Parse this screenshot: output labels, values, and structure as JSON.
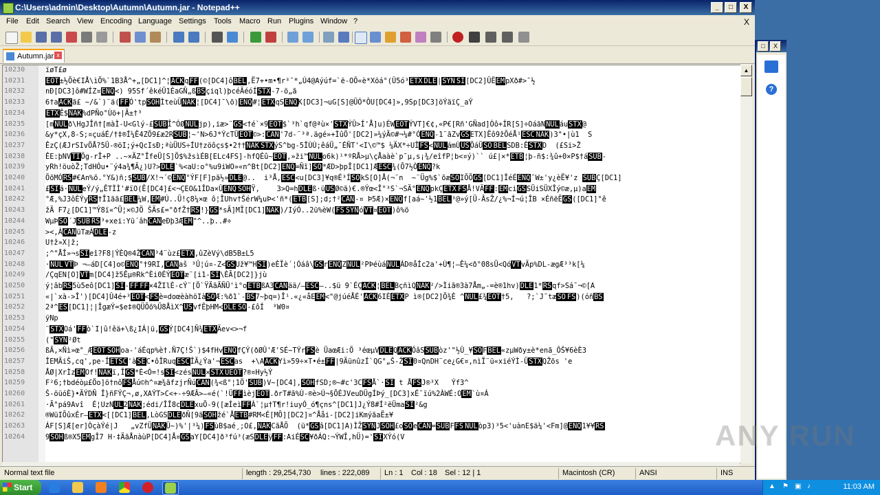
{
  "window": {
    "title": "C:\\Users\\admin\\Desktop\\Autumn\\Autumn.jar - Notepad++"
  },
  "title_buttons": {
    "minimize": "_",
    "maximize": "□",
    "close": "X"
  },
  "menu": [
    "File",
    "Edit",
    "Search",
    "View",
    "Encoding",
    "Language",
    "Settings",
    "Tools",
    "Macro",
    "Run",
    "Plugins",
    "Window",
    "?"
  ],
  "menu_close": "X",
  "tab": {
    "label": "Autumn.jar",
    "close": "x"
  },
  "editor": {
    "lines": [
      {
        "n": "10230",
        "t": "ïøT£ø"
      },
      {
        "n": "10231",
        "t": "[EOT]±½Õè€IÅ\\ìÖ%`1B3Å^+„[DC1]^¦[ACK]q[FF](©[DC4]ô[BEL],Ë7+•m•¶r³¯*„Ú4@Aýúf=`ë-OÔ«è*Xöá°(Û5ó³[ETX][DLE]|[SYN][SI][DC2]ÛË[EM]pXð#>¯½"
      },
      {
        "n": "10232",
        "t": "nÐ[DC3]ô#WÍZ¤[ENQ]<) 95Sf´êkéÜ1ÉaGÑ„ß[BS]çiql)þcéÃéóÍ[STX]-7-ö„ã"
      },
      {
        "n": "10233",
        "t": "6†a[ACK]ã£ ~/&`)¨ä([FF]Ó'tp[SOH]ÌteùÜ[NAK]¦[DC4]¯\\õ)[ENQ]#¦[ETX]qS[ENQ]K[DC3]¬uG[S]@ÜÓ*ÔU[DC4]»,9Sp[DC3]öÝäïÇ_aÝ"
      },
      {
        "n": "10234",
        "t": "[ETX]Ê$[NAK]%dPÑo°Ùö+|Ä±†³"
      },
      {
        "n": "10235",
        "t": "[m[NUL]ð\\HgJÎñ†[màÌ-U<Glý-£[SUB]Î^ÓØ[NUL]jp),iæ>¨[GS]<†é`×9[EOT]$`³h`qf@ªù×'[STX]ÝÛ>Í'Å]u)ÉW[EOT]ÝVT]€¢,«P€[Rñ'GÑad]Òô+ÍR[S]÷OáãN[NUL]áu[STX]@"
      },
      {
        "n": "10236",
        "t": "&y*çX‚8-S;¤çuáÉ/†‡®Í¼Ê4ZÕ9£æ2R[SUB]¦~'N>6J*ÝcTÜ[EOT]©>:[CAN]'7d-¨³ª.ägé»+ÌûÕ'[DC2]»¼ýÃ©#¬¼#°Ó[ENQ]-1¨ãZv[GS]ETX]Ëô9žÕéÅ¹[ESC][NAK])3\"•|ù1  S"
      },
      {
        "n": "10237",
        "t": "ÊzÇ(ÆJrSIvÖÅ?5Ü-®öI;ý+QcIsÐ;ªùÜUS÷ÍU†zöôçs$•2††[NAK][STX]ýS^bg-5ÎÙÙ;êáÜ„¯ÉÑT'<I\\©™$ ¼ÄX*÷UÎ[FS]<[NUL]ámÙ[US]ÕáÜ[SO][BEL]SDB:Ê[STX]D  (£Si>Ž"
      },
      {
        "n": "10238",
        "t": "ÊE:þNV[TI]Ög-rÎ+P ..~×ÄZ°ÎfeÜ[S]Ö$%žsìÉB[ELc4FS]-hfQÉû~[EOT],»ži™[NUL]o6k)¹*ºRÅ>µ\\çÅaàè`p¯µ,s¡¾/eîfP¦b<¤ý)`` ú£|×*[ETB]¦þ-ñ$:¾û+0×P$†á[SUB]-"
      },
      {
        "n": "10239",
        "t": "yRh!öuòŽ;TdHÓu•¨ý4a¾¶Ä¿)U?>[DLE]`%<aU:o°%u9iWO»«n^Bt[DC2][ENQ]=Ñî][SO]*ÆD>þpÎ[DC1]Æ[ESC]¾(Õ7½Ò[ENQ]?k"
      },
      {
        "n": "10240",
        "t": "ÕõMÓ[RS]#€An%õ.°Y&)ñ;$[SUB]/X!¬´©[ENQ]°ÝF[F]pã½»[DLE]@..  i³Å,[ESC]<u[DC3]¥q®É³Í[SO]kS[O]Å(¬¨n  ~¨Üg%$`õæ[SO]IÕÕ[GS][DC1]ÎéÉ[ENQ]¯W±'y¿èË¥'z [SUB]Ç[DC1]"
      },
      {
        "n": "10241",
        "t": "£[SI]ä·[NUL]eÝ/ý„ÊTÌÌ'#ïO(Ê[DC4]£<¬ÇEO&1ÎDa×Û[ENQ][SOH]Ÿ‚    3>Q=h[DLE]ß·ü[US]Ø©ã)€.®Ýœ<Î°³S`¬SÄ°[ENQ]pkÇ[ETX][FS]Å!VÄ[FF]:[EM]ci[GS]SÜiSÜXÎý©æ‚µ)a[EM]"
      },
      {
        "n": "10242",
        "t": "°Æ‚%J3ôÈÝy[RS]†Î1ãã£[BEL]¼W,[EM]#Ú..Ü!ç8¼×œ ô¦ÎUhv†ŠérW¼uÞ<'ñ*([ETB][S];d;†²[CAN]-¤ Þ5Æ)×[ENQ]f[aá~'½1[BEL]³@»ý[Ü-ÂsŽ/¿%¬Í¬ú¦ÎB ×ÉñëË[GS]([DC1]°ê"
      },
      {
        "n": "10243",
        "t": "žÄ F7¿[DC1]™Ý8ï«^Ü¦×©JÖ ŠÄs£=°ðfŽ†[RS]!}[GS]*sÃ]MÏ[DC1][NAK])/IýÓ..2ü%èW([FS][SYN]ó[VT]¤[EOT])ô%ö"
      },
      {
        "n": "10244",
        "t": "WµÞ[SO]´J[SUB][RS]³+xei:Yü´âh[CAN]eÐþ3Æ[EM]°^..þ..#÷"
      },
      {
        "n": "10245",
        "t": "><,À[CAN]üTæÀ[DLE]-z"
      },
      {
        "n": "10246",
        "t": "U†ž»X|ž;"
      },
      {
        "n": "10247",
        "t": ";^\"ÅÎ»¬s[SI]eî?F8|ÝÈQ®4Ž[CAN]³4¨ùz£[ETX],ûZèVý\\dB5B±L5"
      },
      {
        "n": "10248",
        "t": "·[NUL][VT]Þ ¬—áD[C4]o©[ENQ]°†9RI,[CAN]aš ³Û¦ú¤-Z<[GS]Už¥™H[SI])eÈÏè´¦Óáâ\\[GS]r[ENQ]Z[NUL]²PÞéùá[NUL]ÁD®åÍc2a'+Ù¶¦—Ê¼<ð°08sÜ<Qó[VT]vÃp%DL-ægÆ³³k[¼"
      },
      {
        "n": "10249",
        "t": "/ÇqEN[O][VT]m[DC4]ž5Êµ®Rk^Èi0ÉÝ[EOT]æ¨[i1-[SI]\\ÈÃ[DC2]}jù"
      },
      {
        "n": "10250",
        "t": "ý¦âb[RS]5ù5eô[DC1][SI]-[FF][FF]×4ŽIlÈ-cÝ¨[Ö`ŸÄãÃÑÜ'ì°o[ETB]ßA3[CAN]ää/—[ESC]—..$ü 9`ÉÇ[ACK]¦[BEL]BçñìQ[NAK]²/>Ìiã®3à7Åm„-=è®1hv)[DLE]1*[RS]qf>Sá¯¬©[A"
      },
      {
        "n": "10251",
        "t": "«|`xà->Î')[DC4]Û4é+³[EOT]<[FS]è=doœèàhöIà[SO]Æ:%ð1`-[BS]7~þq=)Î¹.«¿«åE[EM]<\"@júéÅÉ'[ACK]6IÈ[ETX]P ì®[DC2]Õ¾È ^[NUL]£¾[EOT]†5,   ?;`J¯tæ[SO][FS])(óñ[BS]"
      },
      {
        "n": "10252",
        "t": "2ª^[ES][DC1]¦|ÎgæÝ=$e‡®QÜÕõ%Ü8ÅìX^[US]vfÊþHM<[DLE][SO]-£ôÍ  ³W0¤"
      },
      {
        "n": "10253",
        "t": "ÿNp"
      },
      {
        "n": "10254",
        "t": "¨[STX]Oá'[FF]ò`I|û!êä+\\ß¿IÁ|ü,[GS]Ý[DC4]Ñ¾[ETX]Äev<>¬f"
      },
      {
        "n": "10255",
        "t": "(\"[SYN]²Øt"
      },
      {
        "n": "10256",
        "t": "ßÃ,×Ñì»œ°_Æ[EOT][SOH]oa-'áÉqp%è†.Ñ7Ç!Š`)$4fHv[ENQ]fÇÝ(ðØÛ'Æ'SÉ~TÝr[FS]è ÜaœÆi:Ö ³éœµV[DLE]Q[ACK]ÔâS[SUB]òz'\"½Û_¥[SO]F[BEL]«zµWðy±è*enã_ÔŠ¥6èÈ3"
      },
      {
        "n": "10257",
        "t": "ÎEMÄiŠ,cq',pe·Î[ETSC]'à[SE]C•ôÎRuq[ESC]ÎÃ¿Ýa'¬[ESC]as  +\\A[ACK]Yì»59÷×T•é±[FF]|9ÄünûzÍ`QG°„Š-Ž[SI]0¤QnDH¨ce¿G€¤,nìÏ¨ü«xiéÝÌ-Ü[STX]QŽõs 'e"
      },
      {
        "n": "10258",
        "t": "ÅØ|XrÌz[EM]Of![NAK]ï,Î[GS]*È<Ó=!s[SI]<zés[NUL]×[STX][UEOT]?®¤Hy½Ý"
      },
      {
        "n": "10259",
        "t": "F²6;†bdéòµ£Öo]ö†nô[FS]Åú©h^¤æ¾ãfzjrÑú[CAN](¾<ß°¦1Ö'[SUB])V~[DC4],[SOH]fSD;®~#c'3C[FS]Å`·[SI] t Å[FS]J®³X   Ýf3^"
      },
      {
        "n": "10260",
        "t": "Š-öüóÈ}•ÄÝDÑ Î}ñFÝÇ¬,ø,XAÝT>C<+-÷9ÆÂ>—«é(`!Ü[FF]ìèj[EOT].ðrT#ã%Ù-®è>Ú¬§ÕÉJVeuDÜgÍÞý_[DC3]xÉ¯ïú%2ÀWÉ:O[EM]`ù¤Á"
      },
      {
        "n": "10261",
        "t": "·Ã°pá9Avî  É¦UzN[UL]2[NAK];édi/ÎÎ8c[DLE]xuÕ-9([æÍeì[FF]À`¦µ†T¶r!iuyÓ_ó¶çns^[DC1]J¿Ý8#Í²ëÜma[SI]²&g"
      },
      {
        "n": "10262",
        "t": "®WüIÕûxÉr—[ETX]<[[DC1][BEL],LòGS[DLE]ðÑ[9ã[SOH]žé`Å[ETB]#RM<É[MÕ][DC2]¤^Ååi-[DC2]iKmýãaË±¥"
      },
      {
        "n": "10263",
        "t": "ÁF[S]Æ[er]ÒçàÝé|J   „vZfÜ[NAK]Ü~)%'|³¼)[FS]ùB$aé¸;O£,[NAK]CãÅÕ  (ü*[GS]â[DC1]A)ÌŽ[SYN]J[SOH]£o[SO]e[CAN]=[SUB]F[FS][NUL]òp3)³5<'uànE$ä¼'<Fm]@[ENQ]1¥¥[RS]"
      },
      {
        "n": "10264",
        "t": "9[SOH]ß®X5[EM]gÎ7 H·‡ÄãÅnàùP[DC4]Å¤[GS]aY[DC4]ð³fú³(æS[DLE]ÿ[FF]:AiÉ[SC]¥ðÁQ:¬ÝWÎ,hÜ)='[SI]XÝó(V"
      }
    ]
  },
  "status": {
    "type": "Normal text file",
    "length": "length : 29,254,730",
    "lines": "lines : 222,089",
    "ln": "Ln : 1",
    "col": "Col : 18",
    "sel": "Sel : 12 | 1",
    "eol": "Macintosh (CR)",
    "encoding": "ANSI",
    "mode": "INS"
  },
  "taskbar": {
    "start": "Start",
    "clock": "11:03 AM"
  },
  "watermark": "ANY RUN"
}
